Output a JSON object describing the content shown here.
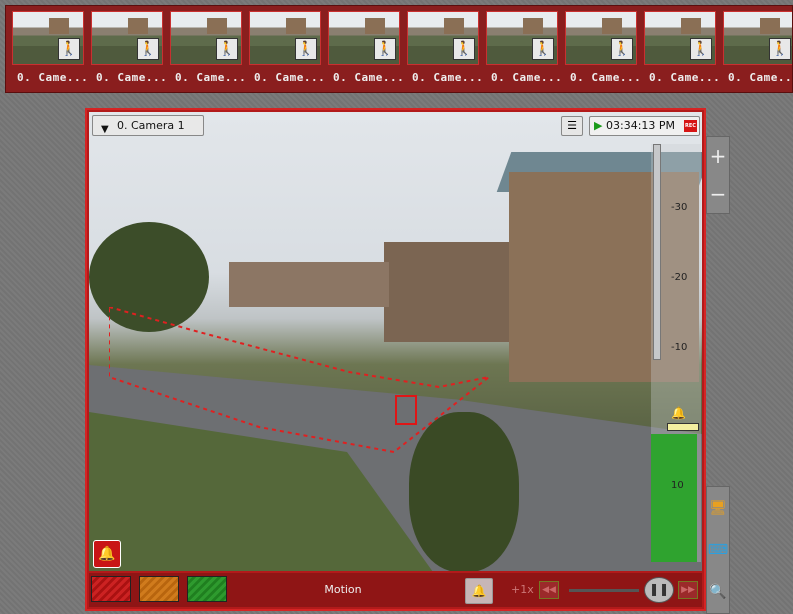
{
  "thumbnails": [
    {
      "label": "0. Came..."
    },
    {
      "label": "0. Came..."
    },
    {
      "label": "0. Came..."
    },
    {
      "label": "0. Came..."
    },
    {
      "label": "0. Came..."
    },
    {
      "label": "0. Came..."
    },
    {
      "label": "0. Came..."
    },
    {
      "label": "0. Came..."
    },
    {
      "label": "0. Came..."
    },
    {
      "label": "0. Came..."
    }
  ],
  "player": {
    "camera_select": "0. Camera 1",
    "time": "03:34:13 PM",
    "rec_badge": "REC",
    "mode_label": "Motion",
    "speed": "+1x",
    "meter_ticks": [
      "-30",
      "-20",
      "-10",
      "10"
    ]
  },
  "side_toolbar": {
    "zoom_in": "+",
    "zoom_out": "−"
  },
  "colors": {
    "accent_red": "#b21a1a",
    "alarm_red": "#d61515",
    "meter_green": "#2fa32f"
  }
}
